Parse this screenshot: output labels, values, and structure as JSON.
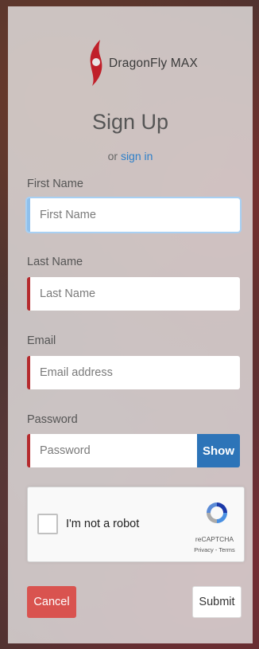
{
  "brand": {
    "name": "DragonFly MAX",
    "logo_icon": "dragonfly-logo-icon",
    "logo_color": "#c0202a"
  },
  "heading": {
    "title": "Sign Up",
    "or_text": "or",
    "signin_link": "sign in"
  },
  "form": {
    "first_name": {
      "label": "First Name",
      "placeholder": "First Name",
      "value": ""
    },
    "last_name": {
      "label": "Last Name",
      "placeholder": "Last Name",
      "value": ""
    },
    "email": {
      "label": "Email",
      "placeholder": "Email address",
      "value": ""
    },
    "password": {
      "label": "Password",
      "placeholder": "Password",
      "value": "",
      "show_label": "Show"
    }
  },
  "captcha": {
    "checkbox_label": "I'm not a robot",
    "brand": "reCAPTCHA",
    "links": "Privacy - Terms"
  },
  "actions": {
    "cancel_label": "Cancel",
    "submit_label": "Submit"
  },
  "colors": {
    "accent_blue": "#2d74b8",
    "error_red": "#b52a2d",
    "cancel_red": "#d9534f"
  }
}
